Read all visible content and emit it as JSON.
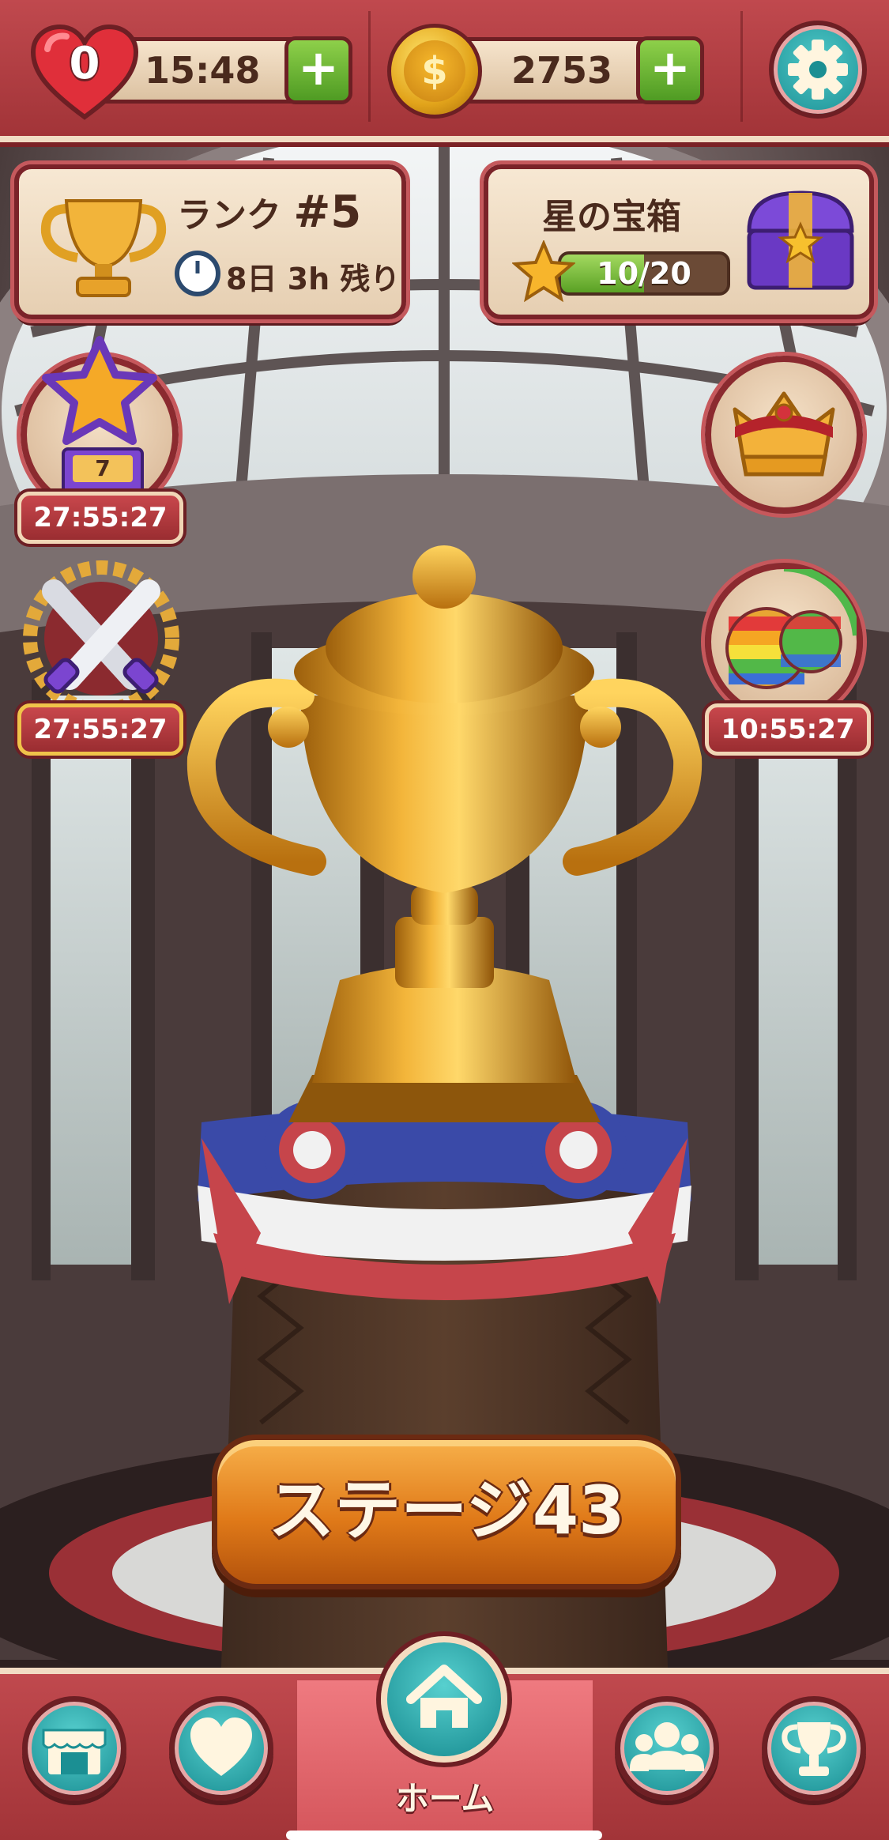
{
  "top_bar": {
    "lives_count": "0",
    "lives_timer": "15:48",
    "coins": "2753",
    "plus_symbol": "+",
    "coin_symbol": "$"
  },
  "rank_panel": {
    "label": "ランク",
    "rank": "#5",
    "time_remaining": "8日 3h 残り"
  },
  "star_chest_panel": {
    "title": "星の宝箱",
    "progress_text": "10/20",
    "progress_fraction": 0.5
  },
  "events": {
    "star_event_level": "7",
    "star_event_timer": "27:55:27",
    "battle_event_timer": "27:55:27",
    "rainbow_event_timer": "10:55:27"
  },
  "stage_button": {
    "label": "ステージ43"
  },
  "bottom_nav": {
    "active_label": "ホーム"
  },
  "colors": {
    "bar_red": "#b23f44",
    "teal_button": "#1b8f93",
    "stage_orange": "#e07a19",
    "gold": "#e2a41b"
  },
  "icons": [
    "heart-icon",
    "coin-icon",
    "gear-icon",
    "trophy-icon",
    "clock-icon",
    "star-icon",
    "treasure-chest-icon",
    "crown-icon",
    "crossed-swords-icon",
    "rainbow-ball-icon",
    "shop-icon",
    "heart-nav-icon",
    "home-icon",
    "friends-icon",
    "trophy-nav-icon"
  ]
}
